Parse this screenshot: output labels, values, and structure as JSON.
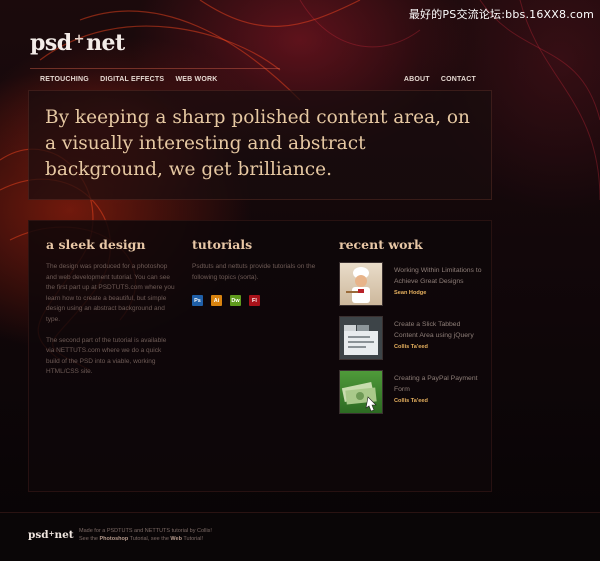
{
  "watermark": "最好的PS交流论坛:bbs.16XX8.com",
  "logo": {
    "left": "psd",
    "plus": "+",
    "right": "net"
  },
  "nav": {
    "left": [
      "RETOUCHING",
      "DIGITAL EFFECTS",
      "WEB WORK"
    ],
    "right": [
      "ABOUT",
      "CONTACT"
    ]
  },
  "hero": {
    "text": "By keeping a sharp polished content area, on a visually interesting and abstract background, we get brilliance."
  },
  "sections": {
    "design": {
      "title": "a sleek design",
      "para1": "The design was produced for a photoshop and web development tutorial.  You can see the first part up at PSDTUTS.com where you learn how to create a beautiful, but simple design using an abstract background and type.",
      "para2": "The second part of the tutorial is available via NETTUTS.com where we do a quick build of the PSD into a viable, working HTML/CSS site."
    },
    "tutorials": {
      "title": "tutorials",
      "text": "Psdtuts and nettuts provide tutorials on the following topics (sorta).",
      "icons": [
        {
          "label": "Ps",
          "color": "#1f5fa8",
          "icon": "photoshop-icon"
        },
        {
          "label": "Ai",
          "color": "#d8830f",
          "icon": "illustrator-icon"
        },
        {
          "label": "Dw",
          "color": "#5f9a1d",
          "icon": "dreamweaver-icon"
        },
        {
          "label": "Fl",
          "color": "#a8121a",
          "icon": "flash-icon"
        }
      ]
    },
    "recent": {
      "title": "recent work",
      "items": [
        {
          "title": "Working Within Limitations to Achieve Great Designs",
          "author": "Sean Hodge",
          "thumb": "chef"
        },
        {
          "title": "Create a Slick Tabbed Content Area using jQuery",
          "author": "Collis Ta'eed",
          "thumb": "tabs"
        },
        {
          "title": "Creating a PayPal Payment Form",
          "author": "Collis Ta'eed",
          "thumb": "money"
        }
      ]
    }
  },
  "footer": {
    "logo_left": "psd",
    "logo_plus": "+",
    "logo_right": "net",
    "line1": "Made for a PSDTUTS and NETTUTS tutorial by Collis!",
    "line2_pre": "See the ",
    "line2_a": "Photoshop",
    "line2_mid": " Tutorial, see the ",
    "line2_b": "Web",
    "line2_post": " Tutorial!"
  },
  "colors": {
    "accent": "#e8c7a6",
    "author": "#e7b15f",
    "background": "#0b0607"
  }
}
